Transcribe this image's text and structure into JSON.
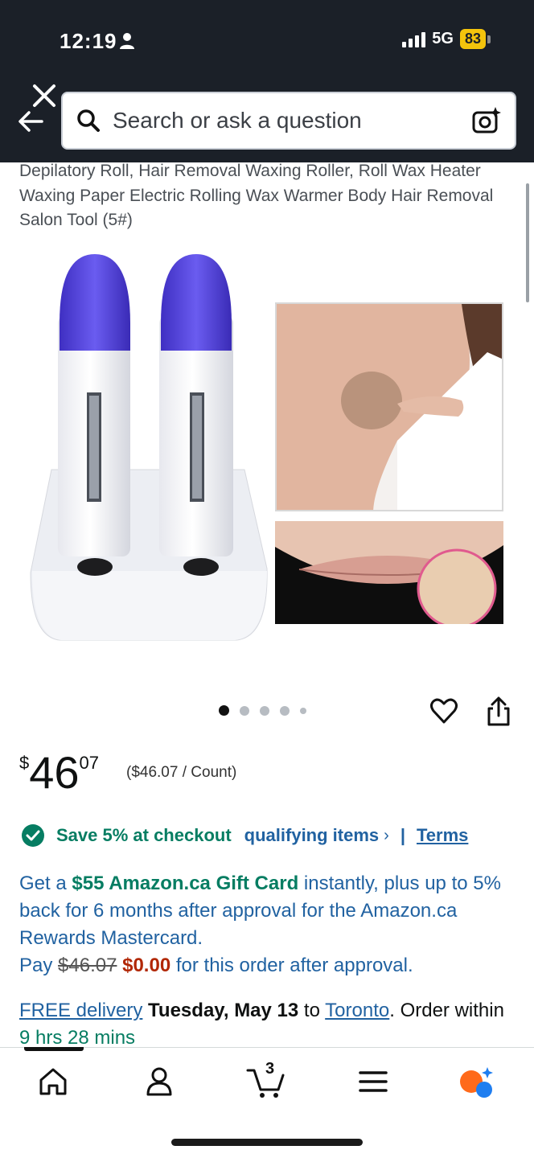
{
  "status_bar": {
    "time": "12:19",
    "network": "5G",
    "battery": "83"
  },
  "header": {
    "search_placeholder": "Search or ask a question"
  },
  "product": {
    "title": "Depilatory Roll, Hair Removal Waxing Roller, Roll Wax Heater Waxing Paper Electric Rolling Wax Warmer Body Hair Removal Salon Tool (5#)",
    "image_count": 5,
    "active_image": 1
  },
  "price": {
    "currency": "$",
    "whole": "46",
    "fraction": "07",
    "unit_price": "($46.07 / Count)"
  },
  "savings": {
    "save_text": "Save 5% at checkout",
    "qualifying": "qualifying items",
    "chevron": "›",
    "separator": "|",
    "terms": "Terms"
  },
  "promo": {
    "prefix": "Get a",
    "gift_card": "$55 Amazon.ca Gift Card",
    "middle": "instantly, plus up to 5% back for 6 months after approval for the Amazon.ca Rewards Mastercard.",
    "pay": "Pay",
    "old_price": "$46.07",
    "new_price": "$0.00",
    "suffix": "for this order after approval."
  },
  "delivery": {
    "free_delivery": "FREE delivery",
    "date": "Tuesday, May 13",
    "to": "to",
    "location": "Toronto",
    "order": ". Order",
    "within": "within",
    "countdown": "9 hrs 28 mins"
  },
  "bottom_nav": {
    "cart_count": "3",
    "items": [
      "home-icon",
      "account-icon",
      "cart-icon",
      "menu-icon",
      "rufus-icon"
    ]
  },
  "colors": {
    "header_bg": "#1b2028",
    "link": "#2162a1",
    "green": "#067d62",
    "red": "#b12704",
    "battery": "#f4c40c"
  }
}
